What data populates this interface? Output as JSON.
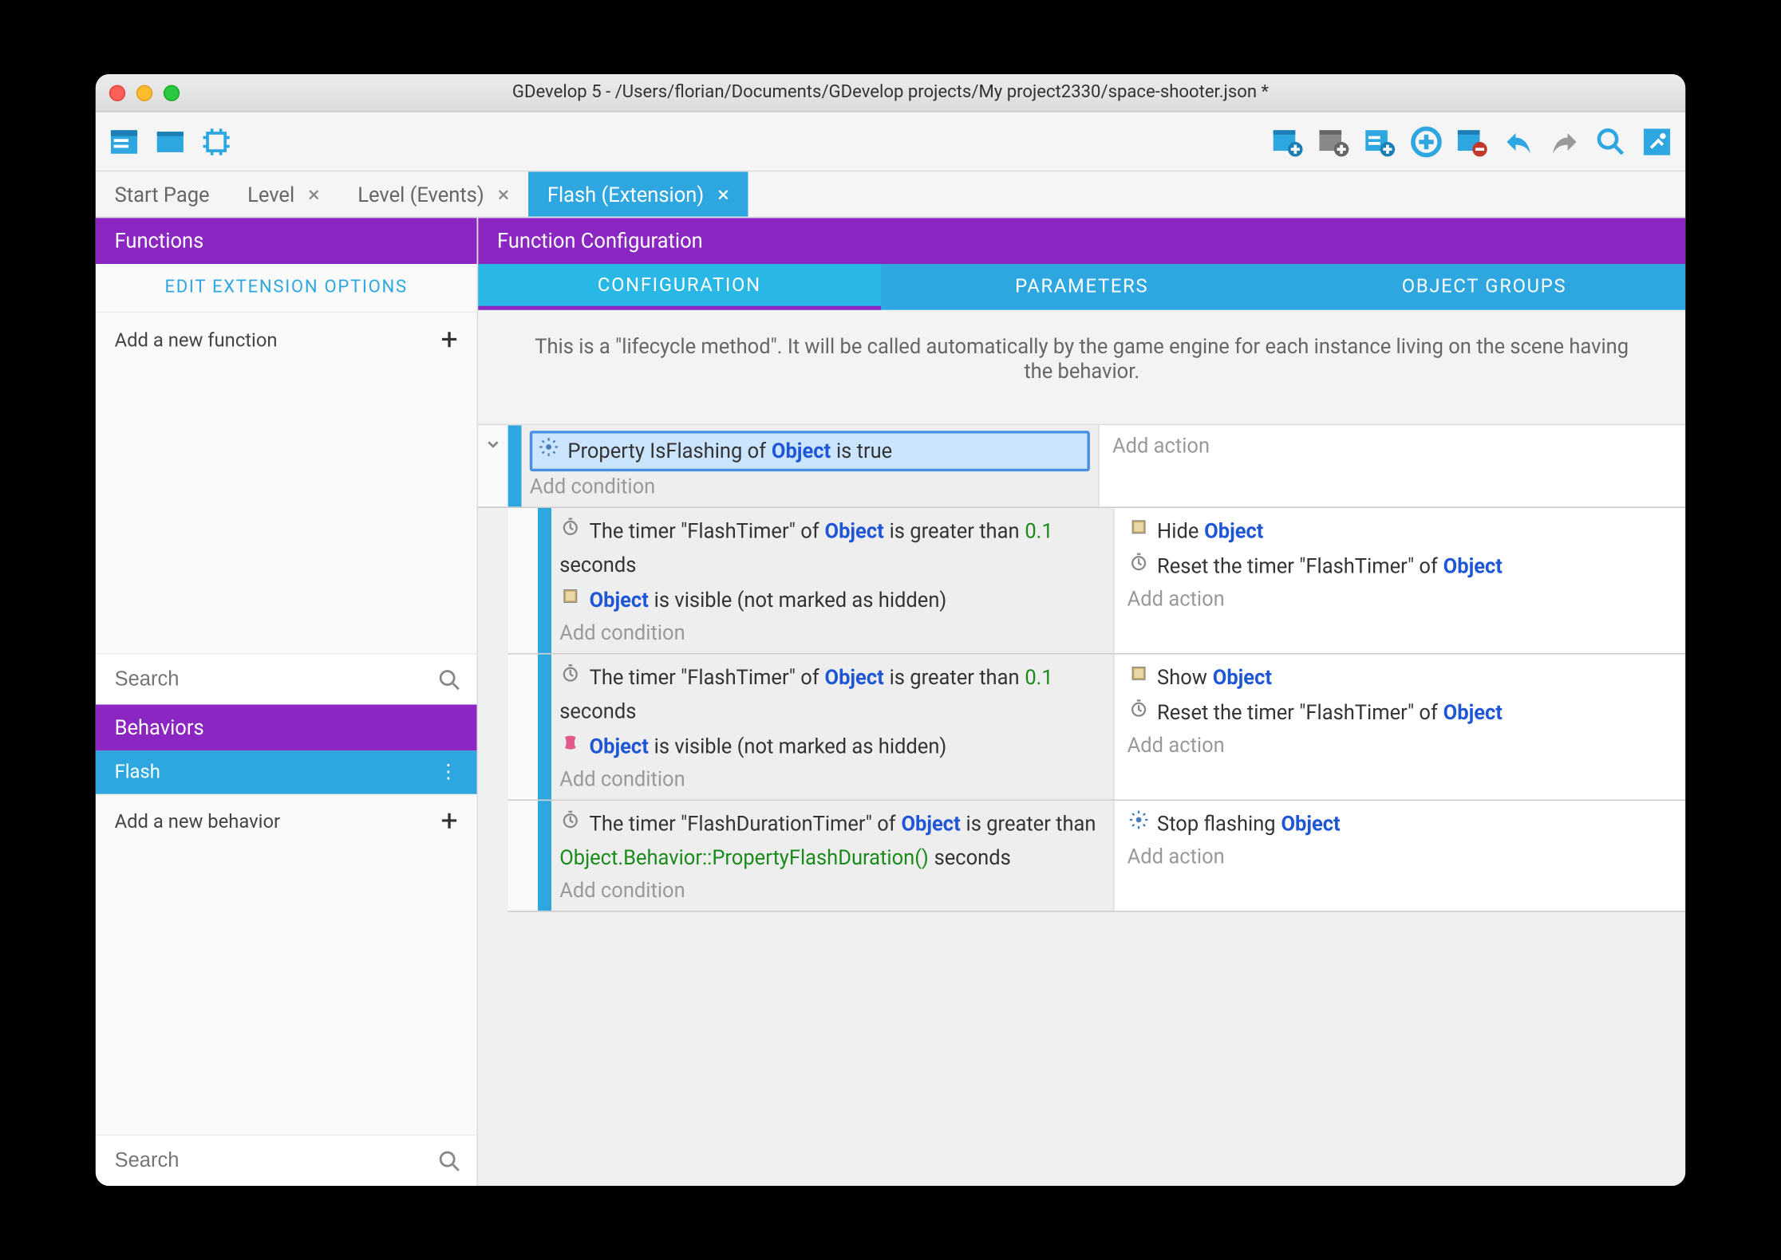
{
  "window": {
    "title": "GDevelop 5 - /Users/florian/Documents/GDevelop projects/My project2330/space-shooter.json *"
  },
  "tabs": [
    {
      "label": "Start Page",
      "closable": false,
      "active": false
    },
    {
      "label": "Level",
      "closable": true,
      "active": false
    },
    {
      "label": "Level (Events)",
      "closable": true,
      "active": false
    },
    {
      "label": "Flash (Extension)",
      "closable": true,
      "active": true
    }
  ],
  "sidebar": {
    "functions_header": "Functions",
    "edit_options": "EDIT EXTENSION OPTIONS",
    "add_function": "Add a new function",
    "search_placeholder": "Search",
    "behaviors_header": "Behaviors",
    "behavior_item": "Flash",
    "add_behavior": "Add a new behavior",
    "search2_placeholder": "Search"
  },
  "main": {
    "header": "Function Configuration",
    "subtabs": {
      "config": "CONFIGURATION",
      "params": "PARAMETERS",
      "groups": "OBJECT GROUPS"
    },
    "description": "This is a \"lifecycle method\". It will be called automatically by the game engine for each instance living on the scene having the behavior.",
    "add_condition": "Add condition",
    "add_action": "Add action",
    "events": [
      {
        "conditions": [
          {
            "icon": "gear",
            "parts": [
              {
                "t": "text",
                "v": "Property IsFlashing of "
              },
              {
                "t": "object",
                "v": "Object"
              },
              {
                "t": "text",
                "v": " is true"
              }
            ],
            "selected": true
          }
        ],
        "actions": []
      },
      {
        "nested": true,
        "conditions": [
          {
            "icon": "timer",
            "parts": [
              {
                "t": "text",
                "v": "The timer \"FlashTimer\" of "
              },
              {
                "t": "object",
                "v": "Object"
              },
              {
                "t": "text",
                "v": " is greater than "
              },
              {
                "t": "num",
                "v": "0.1"
              },
              {
                "t": "text",
                "v": " seconds"
              }
            ]
          },
          {
            "icon": "visible",
            "parts": [
              {
                "t": "object",
                "v": "Object"
              },
              {
                "t": "text",
                "v": " is visible (not marked as hidden)"
              }
            ]
          }
        ],
        "actions": [
          {
            "icon": "visible",
            "parts": [
              {
                "t": "text",
                "v": "Hide "
              },
              {
                "t": "object",
                "v": "Object"
              }
            ]
          },
          {
            "icon": "timer",
            "parts": [
              {
                "t": "text",
                "v": "Reset the timer \"FlashTimer\" of "
              },
              {
                "t": "object",
                "v": "Object"
              }
            ]
          }
        ]
      },
      {
        "nested": true,
        "conditions": [
          {
            "icon": "timer",
            "parts": [
              {
                "t": "text",
                "v": "The timer \"FlashTimer\" of "
              },
              {
                "t": "object",
                "v": "Object"
              },
              {
                "t": "text",
                "v": " is greater than "
              },
              {
                "t": "num",
                "v": "0.1"
              },
              {
                "t": "text",
                "v": " seconds"
              }
            ]
          },
          {
            "icon": "not-visible",
            "parts": [
              {
                "t": "object",
                "v": "Object"
              },
              {
                "t": "text",
                "v": " is visible (not marked as hidden)"
              }
            ]
          }
        ],
        "actions": [
          {
            "icon": "visible",
            "parts": [
              {
                "t": "text",
                "v": "Show "
              },
              {
                "t": "object",
                "v": "Object"
              }
            ]
          },
          {
            "icon": "timer",
            "parts": [
              {
                "t": "text",
                "v": "Reset the timer \"FlashTimer\" of "
              },
              {
                "t": "object",
                "v": "Object"
              }
            ]
          }
        ]
      },
      {
        "nested": true,
        "conditions": [
          {
            "icon": "timer",
            "parts": [
              {
                "t": "text",
                "v": "The timer \"FlashDurationTimer\" of "
              },
              {
                "t": "object",
                "v": "Object"
              },
              {
                "t": "text",
                "v": " is greater than "
              },
              {
                "t": "expr",
                "v": "Object.Behavior::PropertyFlashDuration()"
              },
              {
                "t": "text",
                "v": " seconds"
              }
            ]
          }
        ],
        "actions": [
          {
            "icon": "gear",
            "parts": [
              {
                "t": "text",
                "v": "Stop flashing "
              },
              {
                "t": "object",
                "v": "Object"
              }
            ]
          }
        ]
      }
    ]
  }
}
